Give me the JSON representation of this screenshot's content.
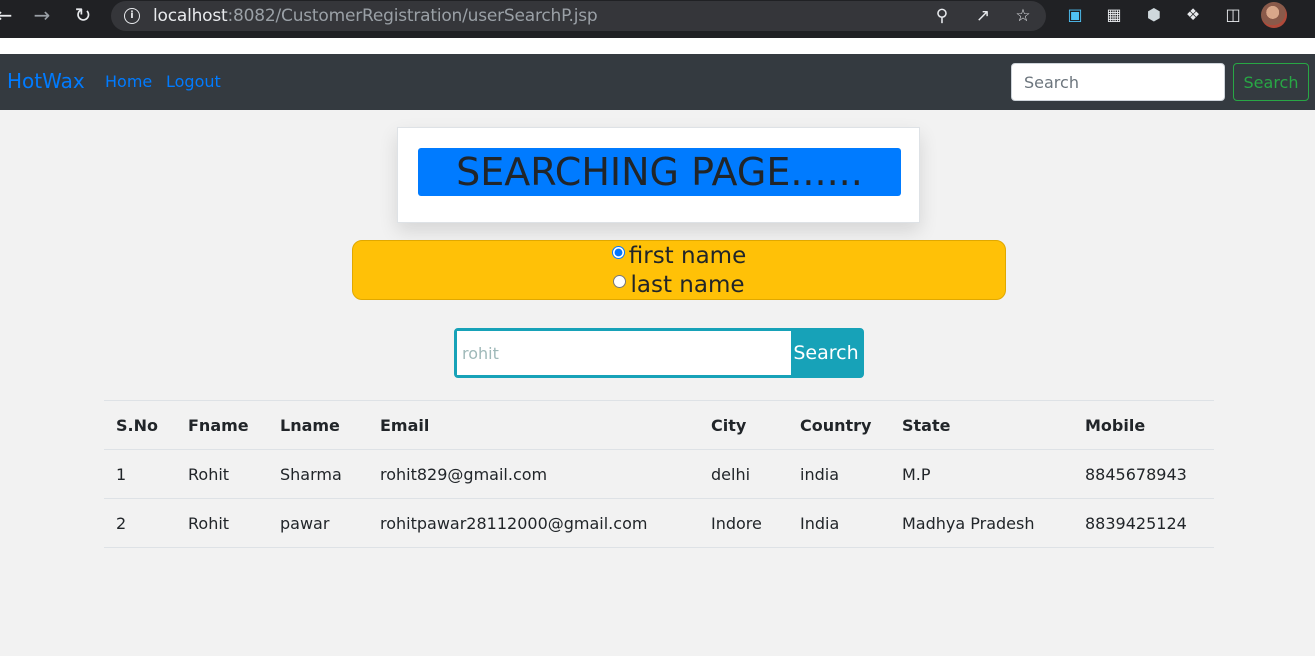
{
  "browser": {
    "url_host": "localhost",
    "url_rest": ":8082/CustomerRegistration/userSearchP.jsp",
    "back_icon": "arrow-left-icon",
    "forward_icon": "arrow-right-icon",
    "reload_icon": "reload-icon"
  },
  "navbar": {
    "brand": "HotWax",
    "links": [
      "Home",
      "Logout"
    ],
    "search_placeholder": "Search",
    "search_button": "Search"
  },
  "heading": {
    "title": "SEARCHING PAGE......"
  },
  "search_options": [
    {
      "label": "first name",
      "checked": true
    },
    {
      "label": "last name",
      "checked": false
    }
  ],
  "search": {
    "placeholder": "rohit",
    "button": "Search"
  },
  "table": {
    "headers": [
      "S.No",
      "Fname",
      "Lname",
      "Email",
      "City",
      "Country",
      "State",
      "Mobile"
    ],
    "rows": [
      [
        "1",
        "Rohit",
        "Sharma",
        "rohit829@gmail.com",
        "delhi",
        "india",
        "M.P",
        "8845678943"
      ],
      [
        "2",
        "Rohit",
        "pawar",
        "rohitpawar28112000@gmail.com",
        "Indore",
        "India",
        "Madhya Pradesh",
        "8839425124"
      ]
    ]
  },
  "colors": {
    "navbar_bg": "#343a40",
    "brand": "#007bff",
    "heading_band": "#007bff",
    "radio_box": "#ffc107",
    "search_accent": "#17a2b8",
    "nav_search_btn": "#28a745"
  }
}
